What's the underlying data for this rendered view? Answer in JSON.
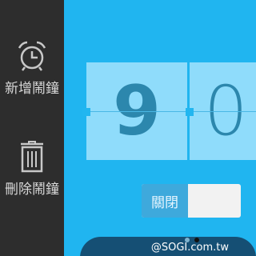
{
  "sidebar": {
    "items": [
      {
        "label": "新增鬧鐘",
        "icon": "alarm-clock-icon"
      },
      {
        "label": "刪除鬧鐘",
        "icon": "trash-icon"
      }
    ]
  },
  "clock": {
    "digits": [
      "9",
      "0"
    ]
  },
  "toggle": {
    "off_label": "關閉"
  },
  "pager": {
    "current_page": 2,
    "total_pages": 2
  },
  "watermark": "@SOGI.com.tw",
  "colors": {
    "background": "#20b5f0",
    "sidebar": "#2d2d2d",
    "card": "#8fdcfb",
    "digit": "#2c87ad",
    "toggle_off": "#3ea9dc",
    "bottom_bar": "#154f74"
  }
}
